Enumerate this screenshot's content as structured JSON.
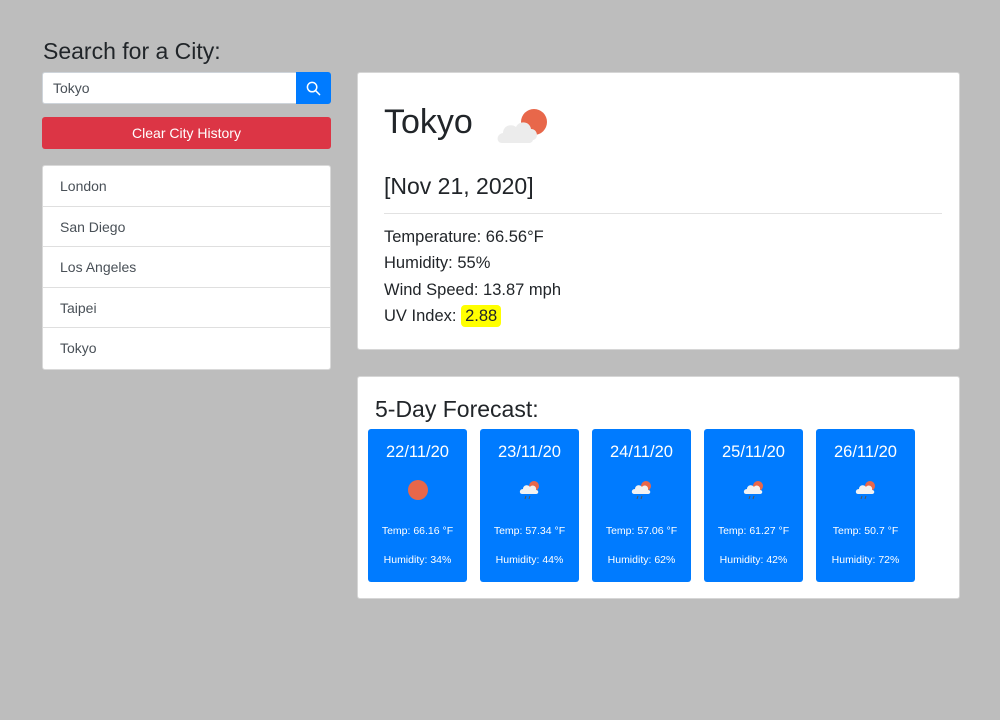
{
  "search": {
    "heading": "Search for a City:",
    "value": "Tokyo",
    "icon": "search-icon",
    "clear_label": "Clear City History"
  },
  "history": [
    "London",
    "San Diego",
    "Los Angeles",
    "Taipei",
    "Tokyo"
  ],
  "current": {
    "city": "Tokyo",
    "icon": "partly-cloudy-icon",
    "date": "[Nov 21, 2020]",
    "temperature": "Temperature: 66.56°F",
    "humidity": "Humidity: 55%",
    "wind": "Wind Speed: 13.87 mph",
    "uv_label": "UV Index:",
    "uv_value": "2.88"
  },
  "forecast": {
    "title": "5-Day Forecast:",
    "days": [
      {
        "date": "22/11/20",
        "icon": "sun-icon",
        "temp": "Temp: 66.16 °F",
        "humidity": "Humidity: 34%"
      },
      {
        "date": "23/11/20",
        "icon": "rain-cloud-icon",
        "temp": "Temp: 57.34 °F",
        "humidity": "Humidity: 44%"
      },
      {
        "date": "24/11/20",
        "icon": "rain-cloud-icon",
        "temp": "Temp: 57.06 °F",
        "humidity": "Humidity: 62%"
      },
      {
        "date": "25/11/20",
        "icon": "rain-cloud-icon",
        "temp": "Temp: 61.27 °F",
        "humidity": "Humidity: 42%"
      },
      {
        "date": "26/11/20",
        "icon": "rain-cloud-icon",
        "temp": "Temp: 50.7 °F",
        "humidity": "Humidity: 72%"
      }
    ]
  },
  "colors": {
    "page_bg": "#bdbdbd",
    "primary": "#007bff",
    "danger": "#dc3545",
    "uv_highlight": "#ffff00",
    "sun": "#e8674a"
  }
}
